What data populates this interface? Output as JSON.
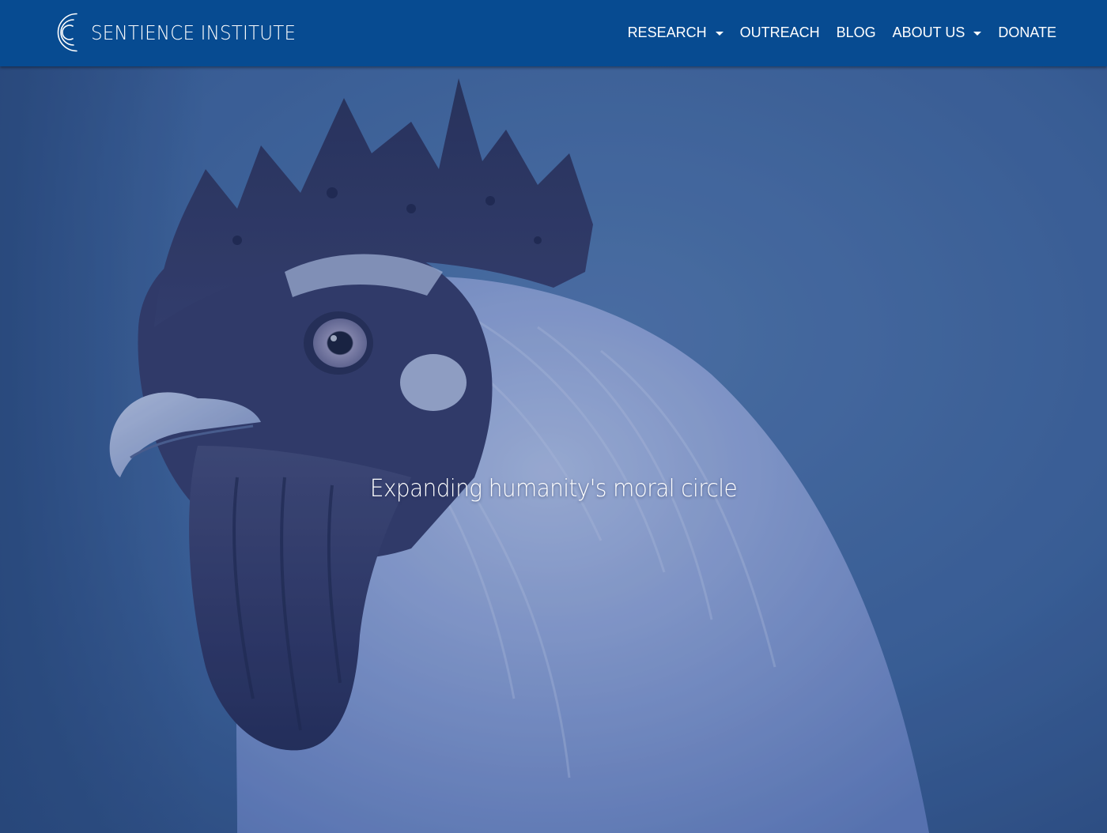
{
  "brand": {
    "name": "SENTIENCE INSTITUTE",
    "logo_icon": "concentric-arcs-logo"
  },
  "nav": {
    "items": [
      {
        "label": "RESEARCH",
        "has_dropdown": true
      },
      {
        "label": "OUTREACH",
        "has_dropdown": false
      },
      {
        "label": "BLOG",
        "has_dropdown": false
      },
      {
        "label": "ABOUT US",
        "has_dropdown": true
      },
      {
        "label": "DONATE",
        "has_dropdown": false
      }
    ]
  },
  "hero": {
    "tagline": "Expanding humanity's moral circle",
    "image_subject": "rooster"
  },
  "colors": {
    "navbar_bg": "#074b91",
    "nav_text": "#ffffff",
    "hero_tint": "#3d5f8f"
  }
}
